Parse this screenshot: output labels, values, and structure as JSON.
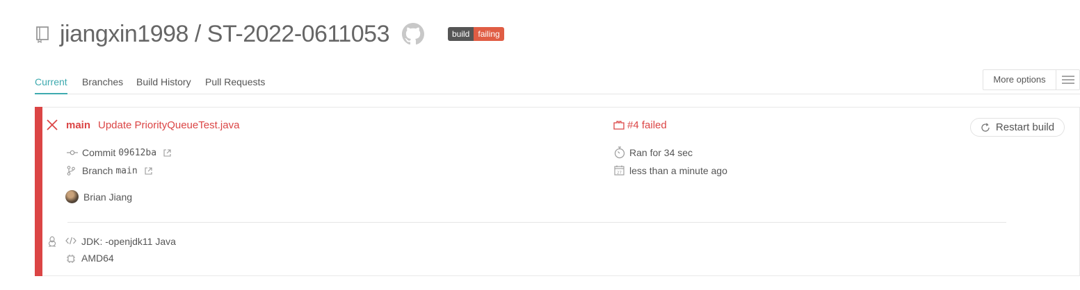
{
  "repo": {
    "owner": "jiangxin1998",
    "separator": "/",
    "name": "ST-2022-0611053"
  },
  "badge": {
    "left": "build",
    "right": "failing"
  },
  "tabs": [
    {
      "label": "Current",
      "active": true
    },
    {
      "label": "Branches"
    },
    {
      "label": "Build History"
    },
    {
      "label": "Pull Requests"
    }
  ],
  "more_options": {
    "label": "More options"
  },
  "build": {
    "branch": "main",
    "message": "Update PriorityQueueTest.java",
    "status": "#4 failed",
    "restart_label": "Restart build",
    "commit_label": "Commit",
    "commit_sha": "09612ba",
    "branch_label": "Branch",
    "branch_name": "main",
    "author": "Brian Jiang",
    "duration": "Ran for 34 sec",
    "finished": "less than a minute ago",
    "jdk": "JDK: -openjdk11 Java",
    "arch": "AMD64"
  },
  "colors": {
    "failed": "#db4545",
    "accent": "#3eaaaf",
    "badge_dark": "#555555",
    "badge_red": "#e05d44"
  }
}
